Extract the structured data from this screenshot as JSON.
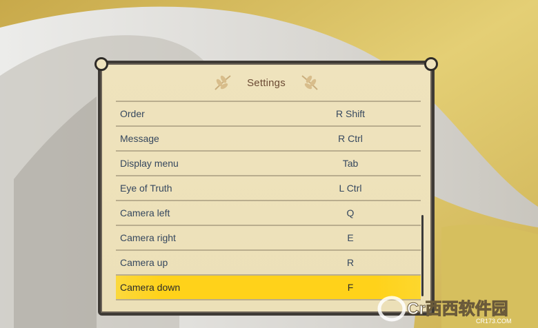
{
  "window": {
    "title": "Settings"
  },
  "keybindings": [
    {
      "action": "Order",
      "key": "R Shift"
    },
    {
      "action": "Message",
      "key": "R Ctrl"
    },
    {
      "action": "Display menu",
      "key": "Tab"
    },
    {
      "action": "Eye of Truth",
      "key": "L Ctrl"
    },
    {
      "action": "Camera left",
      "key": "Q"
    },
    {
      "action": "Camera right",
      "key": "E"
    },
    {
      "action": "Camera up",
      "key": "R"
    },
    {
      "action": "Camera down",
      "key": "F"
    }
  ],
  "selected_index": 7,
  "watermark": {
    "logo_text": "Cr西西软件园",
    "url": "CR173.COM"
  },
  "colors": {
    "panel": "#efe3bd",
    "highlight": "#ffd21a",
    "text": "#35475e",
    "title": "#6b4a33",
    "border": "#3e3a35"
  }
}
